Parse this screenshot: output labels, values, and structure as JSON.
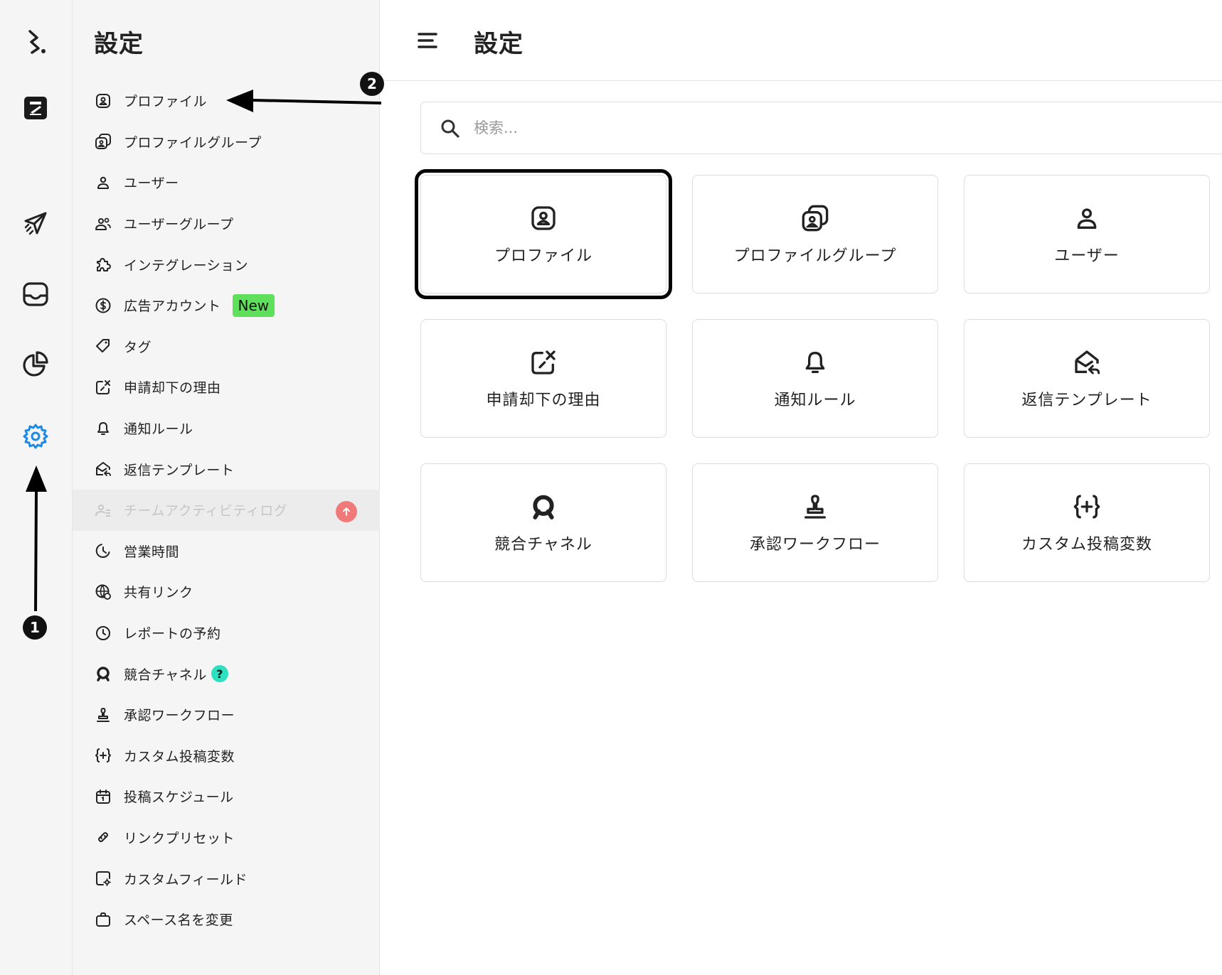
{
  "rail": {
    "items": [
      {
        "name": "logo-icon"
      },
      {
        "name": "workspace-icon"
      },
      {
        "name": "send-icon"
      },
      {
        "name": "inbox-icon"
      },
      {
        "name": "analytics-icon"
      },
      {
        "name": "settings-icon",
        "active": true
      }
    ],
    "accent_color": "#1e88e5"
  },
  "sidebar": {
    "title": "設定",
    "items": [
      {
        "label": "プロファイル",
        "icon": "profile-icon"
      },
      {
        "label": "プロファイルグループ",
        "icon": "profile-group-icon"
      },
      {
        "label": "ユーザー",
        "icon": "user-icon"
      },
      {
        "label": "ユーザーグループ",
        "icon": "user-group-icon"
      },
      {
        "label": "インテグレーション",
        "icon": "puzzle-icon"
      },
      {
        "label": "広告アカウント",
        "icon": "dollar-icon",
        "badge": "New"
      },
      {
        "label": "タグ",
        "icon": "tag-icon"
      },
      {
        "label": "申請却下の理由",
        "icon": "reject-icon"
      },
      {
        "label": "通知ルール",
        "icon": "bell-icon"
      },
      {
        "label": "返信テンプレート",
        "icon": "reply-template-icon"
      },
      {
        "label": "チームアクティビティログ",
        "icon": "activity-log-icon",
        "disabled": true
      },
      {
        "label": "営業時間",
        "icon": "business-hours-icon"
      },
      {
        "label": "共有リンク",
        "icon": "globe-link-icon"
      },
      {
        "label": "レポートの予約",
        "icon": "clock-icon"
      },
      {
        "label": "競合チャネル",
        "icon": "competitor-icon",
        "help": "?"
      },
      {
        "label": "承認ワークフロー",
        "icon": "stamp-icon"
      },
      {
        "label": "カスタム投稿変数",
        "icon": "variable-icon"
      },
      {
        "label": "投稿スケジュール",
        "icon": "calendar-icon"
      },
      {
        "label": "リンクプリセット",
        "icon": "link-icon"
      },
      {
        "label": "カスタムフィールド",
        "icon": "custom-field-icon"
      },
      {
        "label": "スペース名を変更",
        "icon": "briefcase-icon"
      }
    ],
    "new_badge_color": "#5fe05a"
  },
  "main": {
    "title": "設定",
    "search": {
      "placeholder": "検索..."
    },
    "cards": [
      {
        "label": "プロファイル",
        "icon": "profile-icon",
        "selected": true
      },
      {
        "label": "プロファイルグループ",
        "icon": "profile-group-icon"
      },
      {
        "label": "ユーザー",
        "icon": "user-icon"
      },
      {
        "label": "申請却下の理由",
        "icon": "reject-icon"
      },
      {
        "label": "通知ルール",
        "icon": "bell-icon"
      },
      {
        "label": "返信テンプレート",
        "icon": "reply-template-icon"
      },
      {
        "label": "競合チャネル",
        "icon": "competitor-icon"
      },
      {
        "label": "承認ワークフロー",
        "icon": "stamp-icon"
      },
      {
        "label": "カスタム投稿変数",
        "icon": "variable-icon"
      }
    ]
  },
  "annotations": {
    "markers": [
      "1",
      "2"
    ]
  }
}
